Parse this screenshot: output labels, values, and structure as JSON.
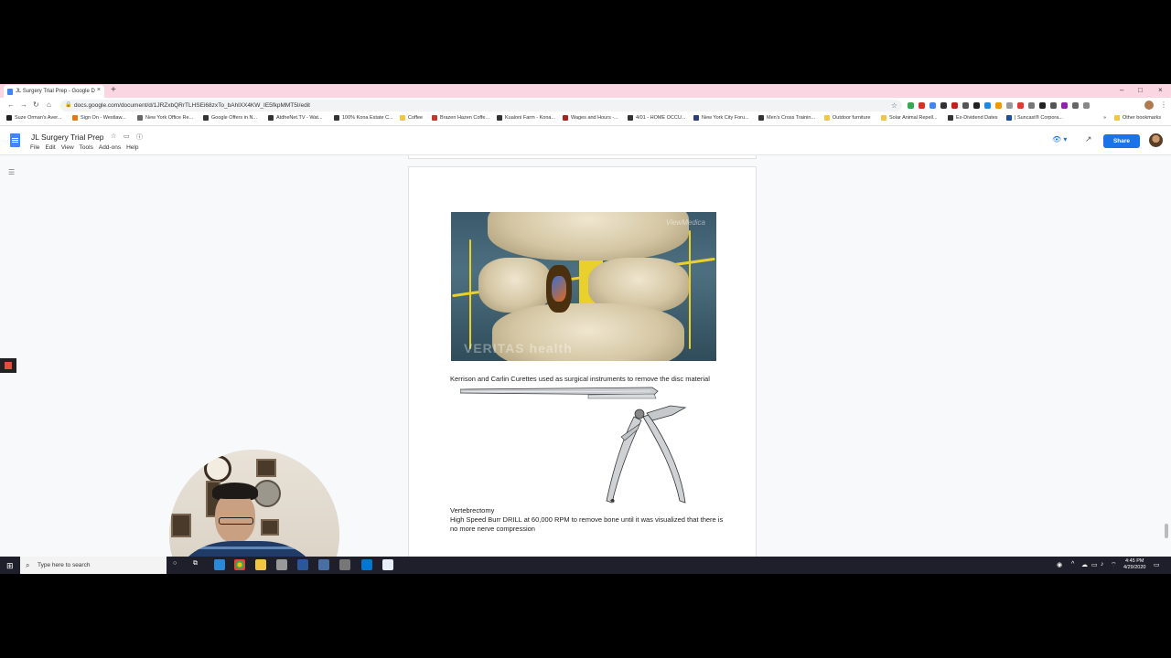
{
  "browser": {
    "tab_title": "JL Surgery Trial Prep - Google D",
    "tab_close": "×",
    "new_tab": "+",
    "window_controls": [
      "–",
      "□",
      "×"
    ],
    "url": "docs.google.com/document/d/1JRZxbQRrTLHSEi68zxTo_bAhlXX4KW_IE5fkpMMT5I/edit",
    "bookmarks": [
      {
        "label": "Suze Orman's Aver...",
        "color": "#222"
      },
      {
        "label": "Sign On - Westlaw...",
        "color": "#e77817"
      },
      {
        "label": "New York Office Re...",
        "color": "#666"
      },
      {
        "label": "Google Offers in N...",
        "color": "#333"
      },
      {
        "label": "AtdheNet.TV - Wat...",
        "color": "#333"
      },
      {
        "label": "100% Kona Estate C...",
        "color": "#333"
      },
      {
        "label": "Coffee",
        "color": "#f4c542"
      },
      {
        "label": "Brazen Hazen Coffe...",
        "color": "#c0392b"
      },
      {
        "label": "Kualoni Farm - Kona...",
        "color": "#333"
      },
      {
        "label": "Wages and Hours -...",
        "color": "#a8231f"
      },
      {
        "label": "4/01 - HOME OCCU...",
        "color": "#333"
      },
      {
        "label": "New York City Foru...",
        "color": "#2c3e7a"
      },
      {
        "label": "Men's Cross Trainin...",
        "color": "#333"
      },
      {
        "label": "Outdoor furniture",
        "color": "#f4c542"
      },
      {
        "label": "Solar Animal Repell...",
        "color": "#f4c542"
      },
      {
        "label": "Ex-Dividend Dates",
        "color": "#333"
      },
      {
        "label": "| Suncast® Corpora...",
        "color": "#1a4d9c"
      }
    ],
    "other_bookmarks": "Other bookmarks"
  },
  "docs": {
    "title": "JL Surgery Trial Prep",
    "menu": [
      "File",
      "Edit",
      "View",
      "Tools",
      "Add-ons",
      "Help"
    ],
    "share_label": "Share",
    "viewing_icon": "👁 ▾",
    "activity_icon": "↗"
  },
  "document": {
    "image1_watermark_top": "ViewMedica",
    "image1_watermark_bottom": "VERITAS health",
    "caption1": "Kerrison and Carlin Curettes used as surgical instruments to remove the disc material",
    "caption2": "Vertebrectomy",
    "caption3": "High Speed Burr DRILL at 60,000 RPM to remove bone until it was visualized that there is no more nerve compression"
  },
  "taskbar": {
    "search_placeholder": "Type here to search",
    "time": "4:45 PM",
    "date": "4/29/2020"
  },
  "colors": {
    "share": "#1a73e8",
    "tabstrip": "#f9d6e1",
    "taskbar": "#1f1f2b"
  }
}
